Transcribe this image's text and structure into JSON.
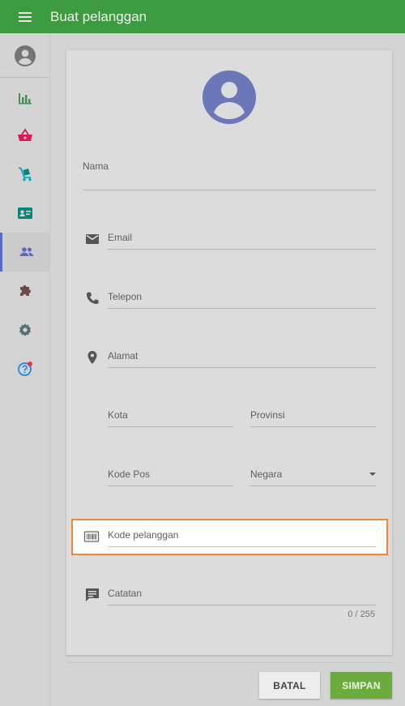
{
  "header": {
    "title": "Buat pelanggan",
    "menu_icon": "hamburger-menu-icon"
  },
  "sidebar": {
    "items": [
      {
        "name": "account-icon",
        "color": "#757575"
      },
      {
        "name": "reports-icon",
        "color": "#3d9a3f"
      },
      {
        "name": "sales-basket-icon",
        "color": "#d81b60"
      },
      {
        "name": "purchase-cart-icon",
        "color": "#00acc1"
      },
      {
        "name": "contact-card-icon",
        "color": "#00897b"
      },
      {
        "name": "customers-icon",
        "color": "#5c6bc0",
        "active": true
      },
      {
        "name": "extensions-icon",
        "color": "#6d4c41"
      },
      {
        "name": "settings-icon",
        "color": "#546e7a"
      },
      {
        "name": "help-icon",
        "color": "#1e88e5",
        "badge_color": "#e53935"
      }
    ]
  },
  "form": {
    "avatar_icon": "person-avatar-icon",
    "avatar_color": "#6b77b8",
    "name_label": "Nama",
    "email_label": "Email",
    "phone_label": "Telepon",
    "address_label": "Alamat",
    "city_label": "Kota",
    "province_label": "Provinsi",
    "postal_label": "Kode Pos",
    "country_label": "Negara",
    "customer_code_label": "Kode pelanggan",
    "notes_label": "Catatan",
    "notes_counter": "0 / 255"
  },
  "actions": {
    "cancel": "BATAL",
    "save": "SIMPAN"
  },
  "colors": {
    "topbar": "#3d9a3f",
    "highlight_border": "#f0873a",
    "save_button": "#6aad3e"
  }
}
